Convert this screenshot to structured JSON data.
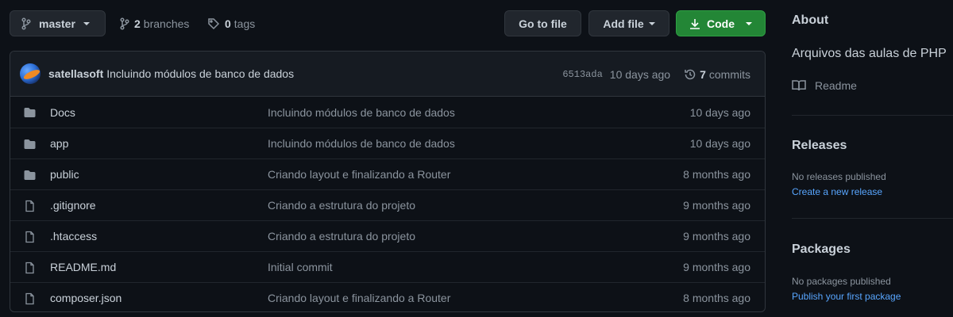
{
  "toolbar": {
    "branch": "master",
    "branches_count": "2",
    "branches_label": "branches",
    "tags_count": "0",
    "tags_label": "tags",
    "goto_file": "Go to file",
    "add_file": "Add file",
    "code": "Code"
  },
  "commit": {
    "author": "satellasoft",
    "message": "Incluindo módulos de banco de dados",
    "sha": "6513ada",
    "ago": "10 days ago",
    "commits_count": "7",
    "commits_label": "commits"
  },
  "files": [
    {
      "name": "Docs",
      "type": "folder",
      "message": "Incluindo módulos de banco de dados",
      "age": "10 days ago"
    },
    {
      "name": "app",
      "type": "folder",
      "message": "Incluindo módulos de banco de dados",
      "age": "10 days ago"
    },
    {
      "name": "public",
      "type": "folder",
      "message": "Criando layout e finalizando a Router",
      "age": "8 months ago"
    },
    {
      "name": ".gitignore",
      "type": "file",
      "message": "Criando a estrutura do projeto",
      "age": "9 months ago"
    },
    {
      "name": ".htaccess",
      "type": "file",
      "message": "Criando a estrutura do projeto",
      "age": "9 months ago"
    },
    {
      "name": "README.md",
      "type": "file",
      "message": "Initial commit",
      "age": "9 months ago"
    },
    {
      "name": "composer.json",
      "type": "file",
      "message": "Criando layout e finalizando a Router",
      "age": "8 months ago"
    }
  ],
  "sidebar": {
    "about_title": "About",
    "about_desc": "Arquivos das aulas de PHP",
    "readme": "Readme",
    "releases_title": "Releases",
    "releases_empty": "No releases published",
    "releases_link": "Create a new release",
    "packages_title": "Packages",
    "packages_empty": "No packages published",
    "packages_link": "Publish your first package"
  },
  "colors": {
    "background": "#0d1117",
    "accent_green": "#238636",
    "link_blue": "#58a6ff",
    "muted": "#8b949e"
  }
}
